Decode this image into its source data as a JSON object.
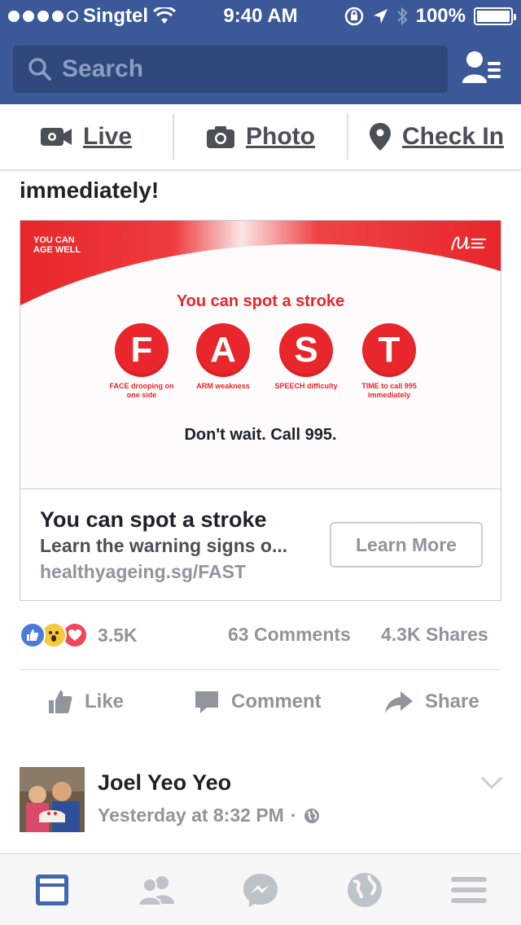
{
  "status_bar": {
    "carrier": "Singtel",
    "time": "9:40 AM",
    "battery": "100%",
    "signal_bars_filled": 4,
    "signal_bars_total": 5
  },
  "search": {
    "placeholder": "Search"
  },
  "composer": {
    "live_label": "Live",
    "photo_label": "Photo",
    "checkin_label": "Check In"
  },
  "post": {
    "text_tail": "immediately!",
    "ad_image": {
      "brand": "YOU CAN AGE WELL",
      "headline": "You can spot a stroke",
      "letters": [
        {
          "letter": "F",
          "label": "FACE drooping on one side"
        },
        {
          "letter": "A",
          "label": "ARM weakness"
        },
        {
          "letter": "S",
          "label": "SPEECH difficulty"
        },
        {
          "letter": "T",
          "label": "TIME to call 995 immediately"
        }
      ],
      "cta": "Don't wait. Call 995."
    },
    "link": {
      "title": "You can spot a stroke",
      "description": "Learn the warning signs o...",
      "url": "healthyageing.sg/FAST",
      "button": "Learn More"
    },
    "reactions_count": "3.5K",
    "comments": "63 Comments",
    "shares": "4.3K Shares",
    "actions": {
      "like": "Like",
      "comment": "Comment",
      "share": "Share"
    }
  },
  "next_post": {
    "author": "Joel Yeo Yeo",
    "timestamp": "Yesterday at 8:32 PM",
    "separator": "·"
  },
  "colors": {
    "brand_blue": "#3b5998",
    "search_bg": "#2f477a",
    "stroke_red": "#e8262b",
    "gray_text": "#90949c",
    "tab_active": "#4267b2",
    "tab_inactive": "#bec2c9"
  },
  "tabbar": {
    "items": [
      "news-feed-icon",
      "friends-icon",
      "messenger-icon",
      "globe-icon",
      "menu-icon"
    ],
    "active": "news-feed-icon"
  }
}
